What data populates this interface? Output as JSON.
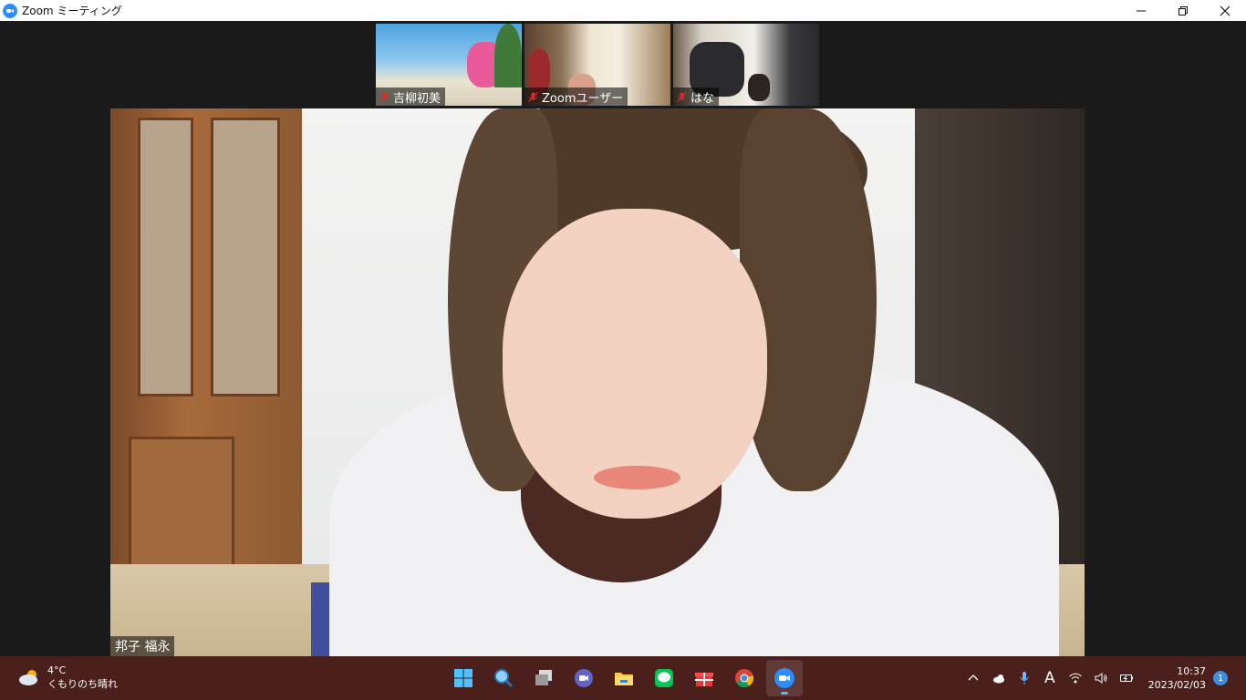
{
  "window": {
    "title": "Zoom ミーティング"
  },
  "thumbnails": [
    {
      "name": "吉柳初美",
      "muted": true
    },
    {
      "name": "Zoomユーザー",
      "muted": true
    },
    {
      "name": "はな",
      "muted": true
    }
  ],
  "active_speaker": {
    "name": "邦子 福永"
  },
  "taskbar": {
    "weather": {
      "temp": "4°C",
      "condition": "くもりのち晴れ"
    },
    "apps": [
      "start-icon",
      "search-icon",
      "task-view-icon",
      "teams-chat-icon",
      "file-explorer-icon",
      "line-icon",
      "gift-icon",
      "chrome-icon",
      "zoom-icon"
    ],
    "ime_mode": "A",
    "clock": {
      "time": "10:37",
      "date": "2023/02/03"
    },
    "notifications": "1"
  },
  "colors": {
    "zoom_blue": "#2d8cff",
    "taskbar_bg": "#4a1f1c",
    "muted_red": "#e02828"
  }
}
